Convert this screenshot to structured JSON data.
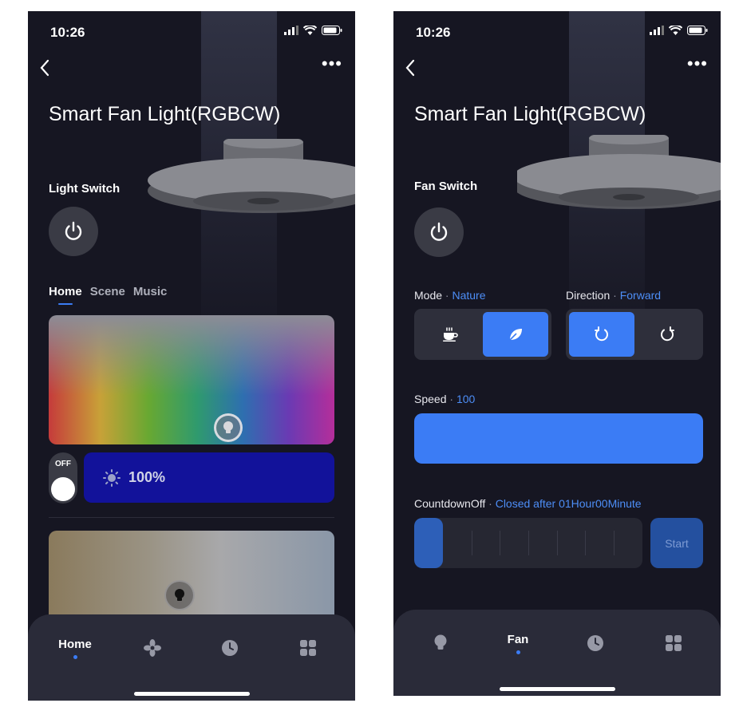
{
  "left": {
    "status": {
      "time": "10:26"
    },
    "title": "Smart Fan Light(RGBCW)",
    "switch_label": "Light Switch",
    "tabs": [
      {
        "label": "Home",
        "active": true
      },
      {
        "label": "Scene",
        "active": false
      },
      {
        "label": "Music",
        "active": false
      }
    ],
    "toggle_label": "OFF",
    "brightness": "100%",
    "nav": [
      {
        "label": "Home",
        "icon": "bulb-icon",
        "active": true
      },
      {
        "label": "",
        "icon": "fan-icon",
        "active": false
      },
      {
        "label": "",
        "icon": "clock-icon",
        "active": false
      },
      {
        "label": "",
        "icon": "grid-icon",
        "active": false
      }
    ]
  },
  "right": {
    "status": {
      "time": "10:26"
    },
    "title": "Smart Fan Light(RGBCW)",
    "switch_label": "Fan Switch",
    "mode": {
      "label": "Mode",
      "value": "Nature"
    },
    "direction": {
      "label": "Direction",
      "value": "Forward"
    },
    "speed": {
      "label": "Speed",
      "value": "100",
      "fraction": 1.0
    },
    "countdown": {
      "label": "CountdownOff",
      "value": "Closed after 01Hour00Minute",
      "start_label": "Start"
    },
    "nav": [
      {
        "label": "",
        "icon": "bulb-icon",
        "active": false
      },
      {
        "label": "Fan",
        "icon": "fan-icon",
        "active": true
      },
      {
        "label": "",
        "icon": "clock-icon",
        "active": false
      },
      {
        "label": "",
        "icon": "grid-icon",
        "active": false
      }
    ]
  },
  "colors": {
    "accent": "#3b7cf5",
    "background": "#161622",
    "nav": "#2a2b39",
    "brightness_bar": "#12129a"
  }
}
